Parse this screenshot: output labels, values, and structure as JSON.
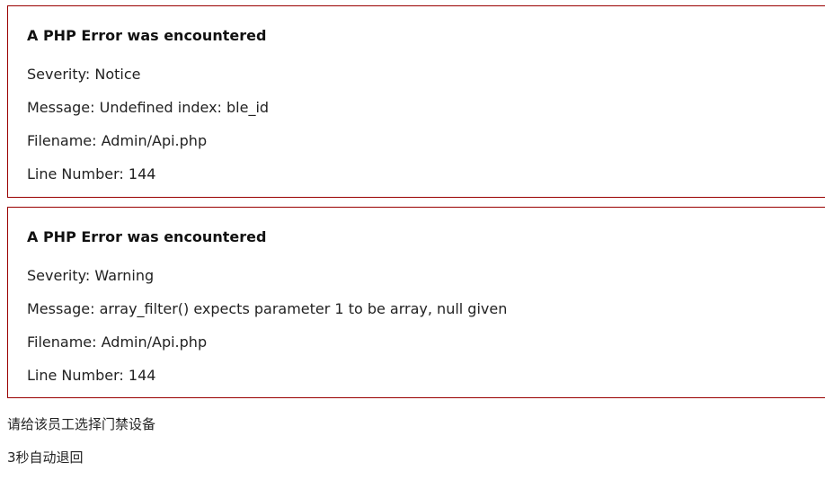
{
  "errors": [
    {
      "title": "A PHP Error was encountered",
      "severity": "Severity: Notice",
      "message": "Message: Undefined index: ble_id",
      "filename": "Filename: Admin/Api.php",
      "line": "Line Number: 144"
    },
    {
      "title": "A PHP Error was encountered",
      "severity": "Severity: Warning",
      "message": "Message: array_filter() expects parameter 1 to be array, null given",
      "filename": "Filename: Admin/Api.php",
      "line": "Line Number: 144"
    }
  ],
  "messages": {
    "prompt": "请给该员工选择门禁设备",
    "redirect": "3秒自动退回"
  },
  "colors": {
    "error_border": "#990000",
    "text": "#222222",
    "background": "#ffffff"
  }
}
